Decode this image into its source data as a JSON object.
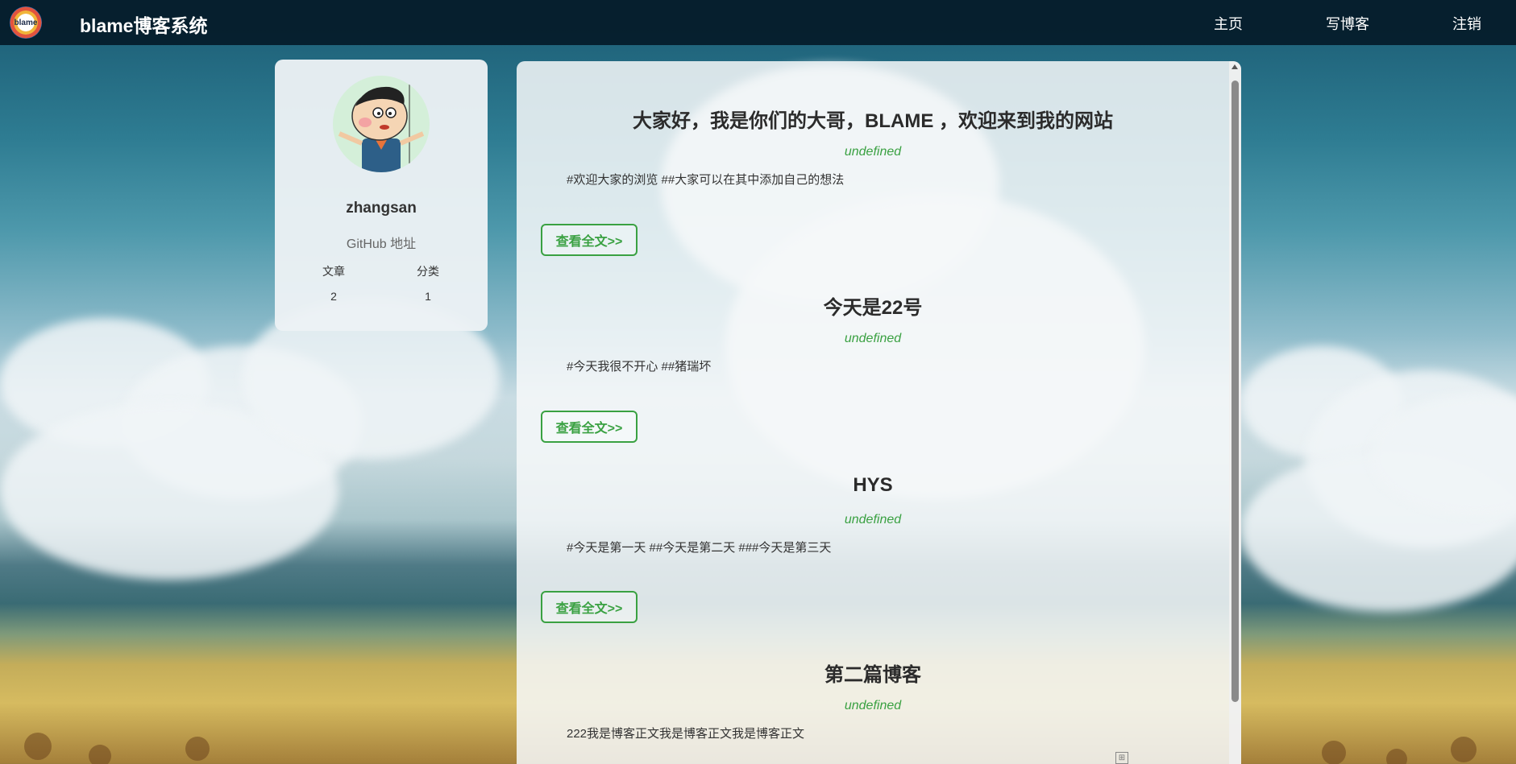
{
  "navbar": {
    "logo_text": "blame",
    "title": "blame博客系统",
    "links": [
      "主页",
      "写博客",
      "注销"
    ]
  },
  "profile": {
    "username": "zhangsan",
    "github": "GitHub 地址",
    "stats": {
      "articles_label": "文章",
      "categories_label": "分类",
      "articles_count": "2",
      "categories_count": "1"
    }
  },
  "posts": [
    {
      "title": "大家好，我是你们的大哥，BLAME ，欢迎来到我的网站",
      "date": "undefined",
      "desc": "#欢迎大家的浏览 ##大家可以在其中添加自己的想法",
      "button": "查看全文>>"
    },
    {
      "title": "今天是22号",
      "date": "undefined",
      "desc": "#今天我很不开心 ##猪瑞坏",
      "button": "查看全文>>"
    },
    {
      "title": "HYS",
      "date": "undefined",
      "desc": "#今天是第一天 ##今天是第二天 ###今天是第三天",
      "button": "查看全文>>"
    },
    {
      "title": "第二篇博客",
      "date": "undefined",
      "desc": "222我是博客正文我是博客正文我是博客正文",
      "button": ""
    }
  ],
  "colors": {
    "navbar_bg": "#041a28",
    "accent_green": "#3aa142",
    "card_bg": "#ecf1f5"
  },
  "icons": [
    "logo-icon",
    "avatar-image",
    "scroll-up-arrow-icon",
    "grid-icon"
  ]
}
